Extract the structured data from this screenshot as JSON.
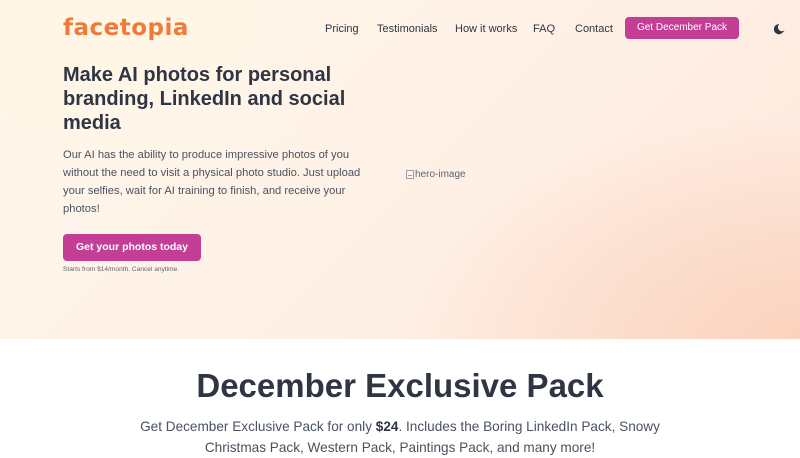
{
  "brand": {
    "logo_text": "facetopia",
    "accent": "#f07a3a"
  },
  "nav": {
    "links": [
      "Pricing",
      "Testimonials",
      "How it works",
      "FAQ",
      "Contact"
    ],
    "cta_label": "Get December Pack",
    "theme_icon": "moon-icon"
  },
  "hero": {
    "title": "Make AI photos for personal branding, LinkedIn and social media",
    "description": "Our AI has the ability to produce impressive photos of you without the need to visit a physical photo studio. Just upload your selfies, wait for AI training to finish, and receive your photos!",
    "cta_label": "Get your photos today",
    "note": "Starts from $14/month. Cancel anytime.",
    "image_alt": "hero-image"
  },
  "december": {
    "title": "December Exclusive Pack",
    "desc_before": "Get December Exclusive Pack for only ",
    "price": "$24",
    "desc_after": ". Includes the Boring LinkedIn Pack, Snowy Christmas Pack, Western Pack, Paintings Pack, and many more!"
  },
  "colors": {
    "primary": "#c43e96",
    "text": "#2f3542",
    "hero_bg": "#fff3e8"
  }
}
